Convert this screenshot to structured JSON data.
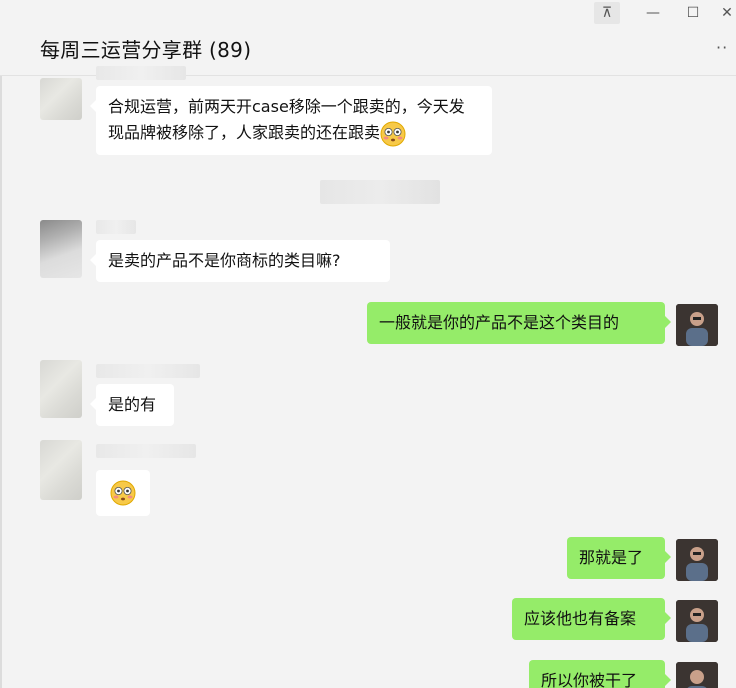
{
  "window": {
    "title": "每周三运营分享群 (89)",
    "controls": {
      "pin": "⊼",
      "minimize": "—",
      "maximize": "☐",
      "close": "✕"
    },
    "more": "··"
  },
  "messages": [
    {
      "side": "in",
      "text": "合规运营，前两天开case移除一个跟卖的，今天发现品牌被移除了，人家跟卖的还在跟卖",
      "emoji": "flushed-face"
    },
    {
      "side": "in",
      "text": "是卖的产品不是你商标的类目嘛?"
    },
    {
      "side": "out",
      "text": "一般就是你的产品不是这个类目的"
    },
    {
      "side": "in",
      "text": "是的有"
    },
    {
      "side": "in",
      "text": "",
      "emoji": "flushed-face"
    },
    {
      "side": "out",
      "text": "那就是了"
    },
    {
      "side": "out",
      "text": "应该他也有备案"
    },
    {
      "side": "out",
      "text": "所以你被干了"
    }
  ],
  "colors": {
    "outgoing_bubble": "#95ec69",
    "incoming_bubble": "#ffffff",
    "background": "#f3f3f3"
  }
}
